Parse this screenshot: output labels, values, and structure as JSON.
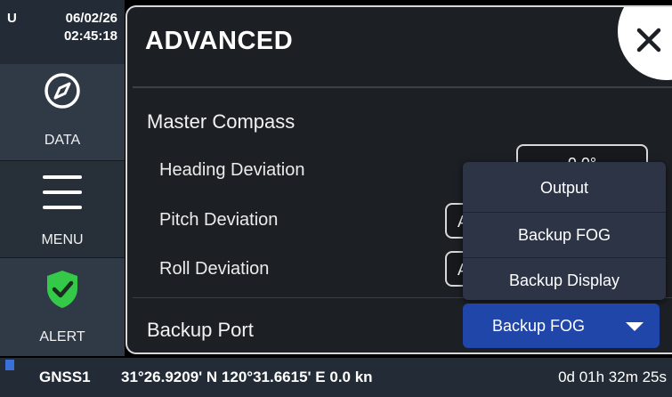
{
  "clock": {
    "mode": "U",
    "date": "06/02/26",
    "time": "02:45:18"
  },
  "rail": {
    "data_label": "DATA",
    "menu_label": "MENU",
    "alert_label": "ALERT",
    "alert_color": "#35c94a"
  },
  "panel": {
    "title": "ADVANCED",
    "master_compass": "Master Compass",
    "heading_label": "Heading Deviation",
    "heading_value": "0.0°",
    "pitch_label": "Pitch Deviation",
    "pitch_value": "A",
    "roll_label": "Roll Deviation",
    "roll_value": "A",
    "backup_port_label": "Backup Port"
  },
  "dropdown": {
    "options": [
      "Output",
      "Backup FOG",
      "Backup Display"
    ],
    "selected": "Backup FOG",
    "accent": "#2046a9"
  },
  "status": {
    "source": "GNSS1",
    "position": "31°26.9209' N  120°31.6615' E  0.0 kn",
    "elapsed": "0d 01h 32m 25s"
  }
}
